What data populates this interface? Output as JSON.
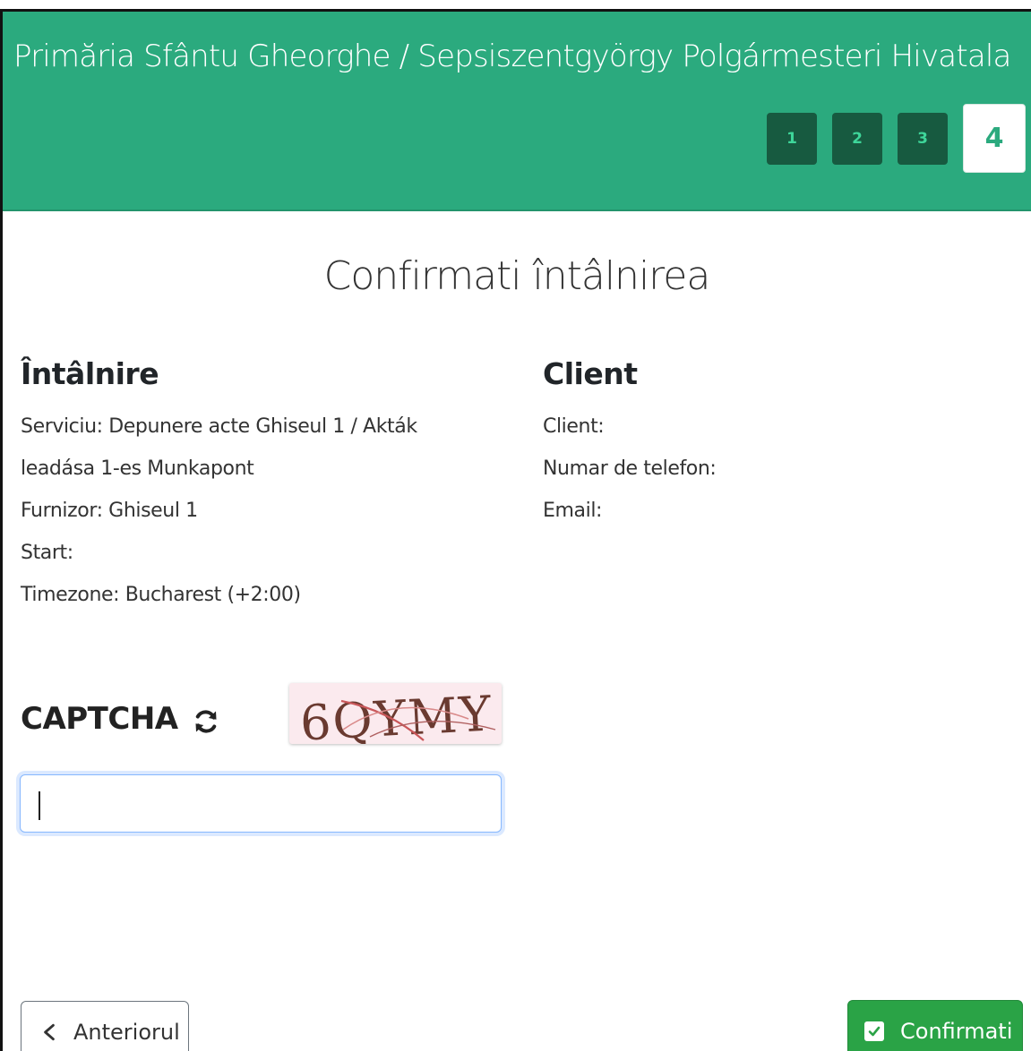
{
  "header": {
    "title": "Primăria Sfântu Gheorghe / Sepsiszentgyörgy Polgármesteri Hivatala",
    "steps": [
      "1",
      "2",
      "3",
      "4"
    ],
    "active_step": "4"
  },
  "page": {
    "heading": "Confirmati întâlnirea"
  },
  "meeting": {
    "heading": "Întâlnire",
    "service_line1": "Serviciu: Depunere acte Ghiseul 1 / Akták",
    "service_line2": "leadása 1-es Munkapont",
    "provider": "Furnizor: Ghiseul 1",
    "start": "Start:",
    "timezone": "Timezone: Bucharest (+2:00)"
  },
  "client": {
    "heading": "Client",
    "client_label": "Client:",
    "phone_label": "Numar de telefon:",
    "email_label": "Email:"
  },
  "captcha": {
    "label": "CAPTCHA",
    "image_text": "6QYMY",
    "input_value": "",
    "refresh_icon": "refresh-icon"
  },
  "buttons": {
    "previous": "Anteriorul",
    "confirm": "Confirmati"
  },
  "colors": {
    "header_bg": "#2baa7e",
    "step_bg": "#175a40",
    "confirm_bg": "#2aa346"
  }
}
